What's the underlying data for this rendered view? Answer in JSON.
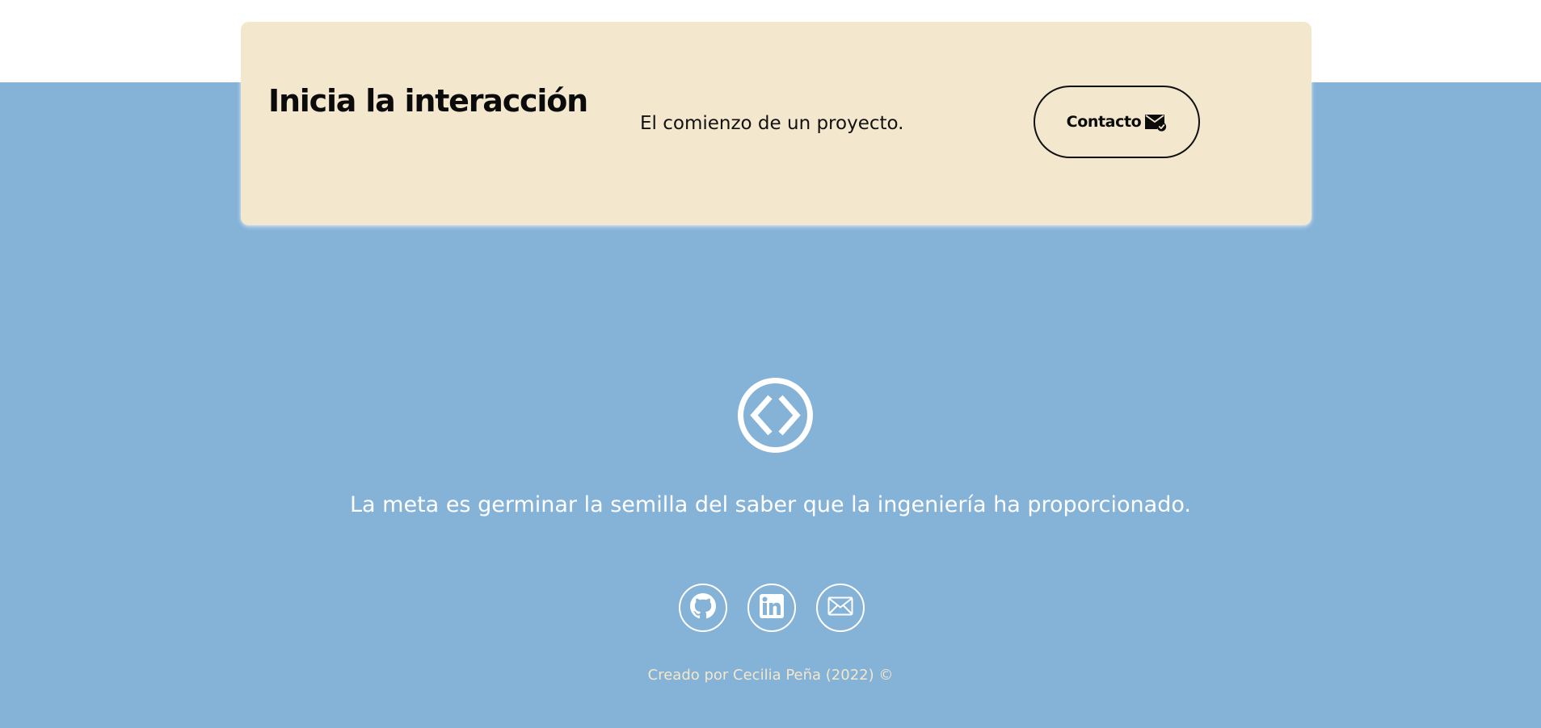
{
  "cta": {
    "title": "Inicia la interacción",
    "subtitle": "El comienzo de un proyecto.",
    "button_label": "Contacto",
    "button_icon": "envelope-check-icon"
  },
  "footer": {
    "logo_icon": "code-brackets-circle-icon",
    "motto": "La meta es germinar la semilla del saber que la ingeniería ha proporcionado.",
    "social": [
      {
        "name": "GitHub",
        "icon": "github-icon"
      },
      {
        "name": "LinkedIn",
        "icon": "linkedin-icon"
      },
      {
        "name": "Email",
        "icon": "envelope-icon"
      }
    ],
    "credit": "Creado por Cecilia Peña (2022) ©"
  },
  "colors": {
    "footer_background": "#85b2d7",
    "card_background": "#f3e7cd",
    "credit_text": "#f3e7cd",
    "text_dark": "#0b0b0b",
    "text_light": "#ffffff"
  }
}
